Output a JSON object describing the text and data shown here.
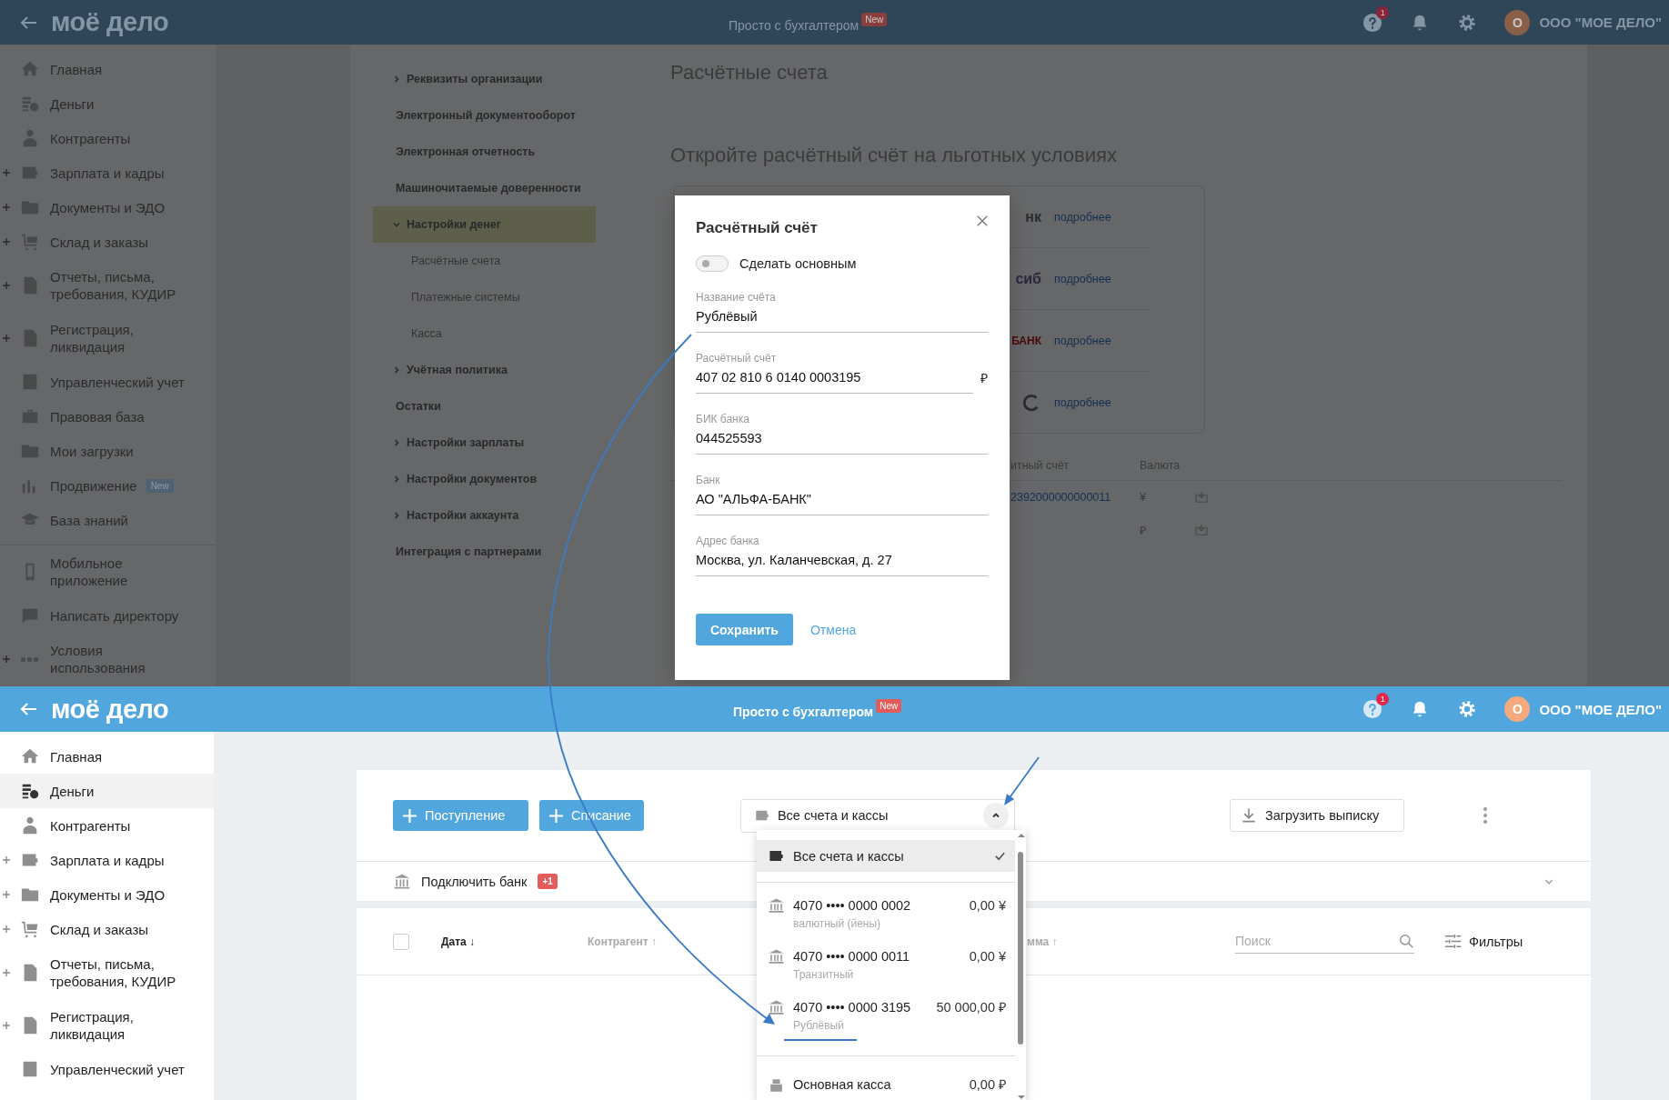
{
  "top_screen": {
    "header": {
      "logo": "моё дело",
      "tagline": "Просто с бухгалтером",
      "tagline_badge": "New",
      "help_count": "1",
      "avatar": "О",
      "company": "ООО \"МОЕ ДЕЛО\""
    },
    "sidebar": {
      "items": [
        {
          "label": "Главная",
          "expandable": false
        },
        {
          "label": "Деньги",
          "expandable": false
        },
        {
          "label": "Контрагенты",
          "expandable": false
        },
        {
          "label": "Зарплата и кадры",
          "expandable": true
        },
        {
          "label": "Документы и ЭДО",
          "expandable": true
        },
        {
          "label": "Склад и заказы",
          "expandable": true
        },
        {
          "label": "Отчеты, письма, требования, КУДИР",
          "expandable": true
        },
        {
          "label": "Регистрация, ликвидация",
          "expandable": true
        },
        {
          "label": "Управленческий учет",
          "expandable": false
        },
        {
          "label": "Правовая база",
          "expandable": false
        },
        {
          "label": "Мои загрузки",
          "expandable": false
        },
        {
          "label": "Продвижение",
          "expandable": false,
          "badge": "New"
        },
        {
          "label": "База знаний",
          "expandable": false
        }
      ],
      "bottom_items": [
        {
          "label": "Мобильное приложение",
          "expandable": false
        },
        {
          "label": "Написать директору",
          "expandable": false
        },
        {
          "label": "Условия использования",
          "expandable": true
        }
      ]
    },
    "settings_nav": [
      {
        "label": "Реквизиты организации",
        "expanded": false,
        "selected": false
      },
      {
        "label": "Электронный документооборот",
        "selected": false
      },
      {
        "label": "Электронная отчетность",
        "selected": false
      },
      {
        "label": "Машиночитаемые доверенности",
        "selected": false
      },
      {
        "label": "Настройки денег",
        "expanded": true,
        "selected": true,
        "children": [
          {
            "label": "Расчётные счета",
            "selected": false
          },
          {
            "label": "Платежные системы",
            "selected": false
          },
          {
            "label": "Касса",
            "selected": false
          }
        ]
      },
      {
        "label": "Учётная политика",
        "expanded": false,
        "selected": false
      },
      {
        "label": "Остатки",
        "selected": false
      },
      {
        "label": "Настройки зарплаты",
        "expanded": false,
        "selected": false
      },
      {
        "label": "Настройки документов",
        "expanded": false,
        "selected": false
      },
      {
        "label": "Настройки аккаунта",
        "expanded": false,
        "selected": false
      },
      {
        "label": "Интеграция с партнерами",
        "selected": false
      }
    ],
    "page_title": "Расчётные счета",
    "promo_title": "Откройте расчётный счёт на льготных условиях",
    "bank_offers": [
      {
        "kind": "text",
        "logo": "нк",
        "color": "#2a2b2c",
        "link": "подробнее"
      },
      {
        "kind": "text",
        "logo": "сиб",
        "color": "#2c2640",
        "link": "подробнее"
      },
      {
        "kind": "text",
        "logo": "БАНК",
        "color": "#4a0808",
        "link": "подробнее"
      },
      {
        "kind": "ring",
        "link": "подробнее"
      }
    ],
    "accounts_table": {
      "columns": [
        "итный счёт",
        "Валюта"
      ],
      "rows": [
        {
          "account": "2392000000000011",
          "currency": "¥"
        },
        {
          "currency": "₽"
        }
      ]
    },
    "modal": {
      "title": "Расчётный счёт",
      "toggle": {
        "label": "Сделать основным",
        "on": false
      },
      "fields": [
        {
          "label": "Название счёта",
          "value": "Рублёвый"
        },
        {
          "label": "Расчётный счёт",
          "value": "407 02 810 6 0140 0003195",
          "suffix": "₽"
        },
        {
          "label": "БИК банка",
          "value": "044525593"
        },
        {
          "label": "Банк",
          "value": "АО \"АЛЬФА-БАНК\""
        },
        {
          "label": "Адрес банка",
          "value": "Москва, ул. Каланчевская, д. 27"
        }
      ],
      "save": "Сохранить",
      "cancel": "Отмена"
    }
  },
  "bottom_screen": {
    "header": {
      "logo": "моё дело",
      "tagline": "Просто с бухгалтером",
      "tagline_badge": "New",
      "help_count": "1",
      "avatar": "О",
      "company": "ООО \"МОЕ ДЕЛО\""
    },
    "sidebar": {
      "items": [
        {
          "label": "Главная",
          "expandable": false,
          "selected": false
        },
        {
          "label": "Деньги",
          "expandable": false,
          "selected": true
        },
        {
          "label": "Контрагенты",
          "expandable": false,
          "selected": false
        },
        {
          "label": "Зарплата и кадры",
          "expandable": true,
          "selected": false
        },
        {
          "label": "Документы и ЭДО",
          "expandable": true,
          "selected": false
        },
        {
          "label": "Склад и заказы",
          "expandable": true,
          "selected": false
        },
        {
          "label": "Отчеты, письма, требования, КУДИР",
          "expandable": true,
          "selected": false
        },
        {
          "label": "Регистрация, ликвидация",
          "expandable": true,
          "selected": false
        },
        {
          "label": "Управленческий учет",
          "expandable": false,
          "selected": false
        }
      ]
    },
    "toolbar": {
      "actions": [
        "Поступление",
        "Списание"
      ],
      "account_select": {
        "value": "Все счета и кассы",
        "expanded": true
      },
      "upload": "Загрузить выписку"
    },
    "connect_bank": {
      "label": "Подключить банк",
      "badge": "+1"
    },
    "table": {
      "select_all_checked": false,
      "columns": [
        {
          "label": "Дата ↓",
          "active": true
        },
        {
          "label": "Контрагент ↑",
          "active": false
        },
        {
          "label": "мма ↑",
          "active": false
        }
      ],
      "search_placeholder": "Поиск",
      "filters": "Фильтры"
    },
    "dropdown": {
      "items": [
        {
          "kind": "all",
          "label": "Все счета и кассы",
          "selected": true
        },
        {
          "kind": "account",
          "label": "4070 •••• 0000 0002",
          "amount": "0,00 ¥",
          "note": "валютный (йены)",
          "selected": false,
          "annotated": false
        },
        {
          "kind": "account",
          "label": "4070 •••• 0000 0011",
          "amount": "0,00 ¥",
          "note": "Транзитный",
          "selected": false,
          "annotated": false
        },
        {
          "kind": "account",
          "label": "4070 •••• 0000 3195",
          "amount": "50 000,00 ₽",
          "note": "Рублёвый",
          "selected": false,
          "annotated": true
        },
        {
          "kind": "cash",
          "label": "Основная касса",
          "amount": "0,00 ₽",
          "selected": false
        }
      ]
    }
  }
}
